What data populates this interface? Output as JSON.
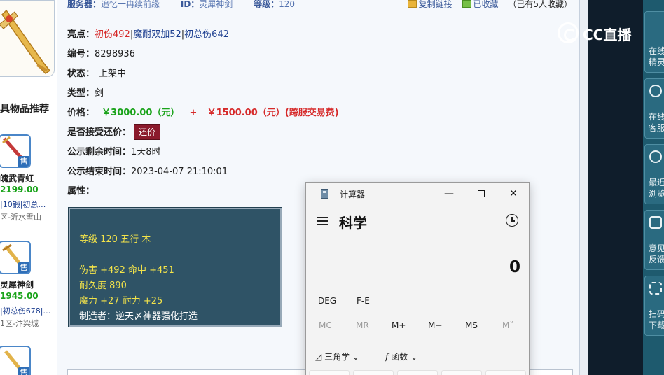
{
  "topline": {
    "server_label": "服务器：",
    "server_value": "追忆一冉续前缘",
    "id_label": "ID：",
    "id_value": "灵犀神剑",
    "level_label": "等级：",
    "level_value": "120",
    "copy_link": "复制链接",
    "favorited": "已收藏",
    "fav_count": "（已有5人收藏）"
  },
  "detail": {
    "highlight_label": "亮点：",
    "highlight_1": "初伤492",
    "highlight_sep1": "|",
    "highlight_2": "魔耐双加52",
    "highlight_sep2": "|",
    "highlight_3": "初总伤642",
    "number_label": "编号：",
    "number_value": "8298936",
    "status_label": "状态：",
    "status_value": "上架中",
    "type_label": "类型：",
    "type_value": "剑",
    "price_label": "价格：",
    "price_main": "￥3000.00（元）",
    "price_plus": "+",
    "price_fee": "￥1500.00（元）(跨服交易费)",
    "counter_label": "是否接受还价：",
    "counter_button": "还价",
    "remaining_label": "公示剩余时间：",
    "remaining_value": "1天8时",
    "end_label": "公示结束时间：",
    "end_value": "2023-04-07 21:10:01",
    "attr_label": "属性："
  },
  "attr_box": {
    "line1": "等级 120 五行 木",
    "line2": "伤害 +492 命中 +451",
    "line3": "耐久度 890",
    "line4": "魔力 +27 耐力 +25",
    "line5": "制造者：逆天〆神器强化打造"
  },
  "recommend": {
    "title": "具物品推荐",
    "items": [
      {
        "name": "魄武青虹",
        "price": "2199.00",
        "attrs": "|10锻|初总…",
        "server": "区-沂水雪山",
        "tag": "售"
      },
      {
        "name": "灵犀神剑",
        "price": "1945.00",
        "attrs": "|初总伤678|…",
        "server": "1区-汴梁城",
        "tag": "售"
      },
      {
        "name": "",
        "price": "",
        "attrs": "",
        "server": "",
        "tag": "售"
      }
    ]
  },
  "overlay": {
    "cc_brand": "CC直播"
  },
  "sidebar": {
    "items": [
      {
        "label1": "在线",
        "label2": "精灵"
      },
      {
        "label1": "在线",
        "label2": "客服"
      },
      {
        "label1": "最近",
        "label2": "浏览"
      },
      {
        "label1": "意见",
        "label2": "反馈"
      },
      {
        "label1": "扫码",
        "label2": "下载"
      }
    ]
  },
  "calculator": {
    "title": "计算器",
    "mode": "科学",
    "display": "0",
    "angle": "DEG",
    "fe": "F-E",
    "memory": [
      "MC",
      "MR",
      "M+",
      "M−",
      "MS",
      "M˅"
    ],
    "trig": "三角学",
    "func": "函数",
    "minimize": "—",
    "close": "✕"
  },
  "colors": {
    "accent_red": "#d62a2a",
    "price_green": "#1aa31a",
    "counter_button": "#8b1a2c",
    "attr_box_bg": "#2f5366",
    "attr_yellow": "#f3e34a"
  }
}
